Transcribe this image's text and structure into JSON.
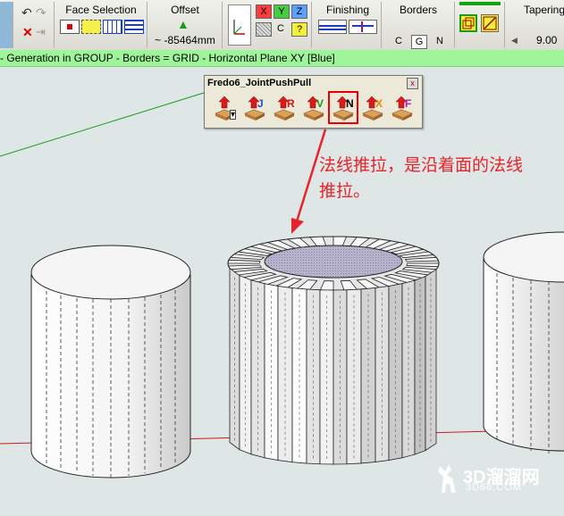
{
  "toolbar": {
    "face_selection_label": "Face Selection",
    "offset_label": "Offset",
    "offset_value": "~ -85464mm",
    "axis_x": "X",
    "axis_y": "Y",
    "axis_z": "Z",
    "axis_c": "C",
    "axis_q": "?",
    "finishing_label": "Finishing",
    "borders_label": "Borders",
    "borders_c": "C",
    "borders_g": "G",
    "borders_n": "N",
    "tapering_label": "Tapering",
    "tapering_value": "9.00"
  },
  "status": {
    "text": "- Generation in GROUP - Borders = GRID - Horizontal Plane XY [Blue]"
  },
  "palette": {
    "title": "Fredo6_JointPushPull",
    "close_label": "x",
    "tools": [
      {
        "letter": "",
        "color": "#000000",
        "icon": "push-pull-menu-icon"
      },
      {
        "letter": "J",
        "color": "#1e4fd6",
        "icon": "joint-push-pull-icon"
      },
      {
        "letter": "R",
        "color": "#d01818",
        "icon": "round-push-pull-icon"
      },
      {
        "letter": "V",
        "color": "#1a9a1a",
        "icon": "vector-push-pull-icon"
      },
      {
        "letter": "N",
        "color": "#000000",
        "icon": "normal-push-pull-icon"
      },
      {
        "letter": "X",
        "color": "#e08a00",
        "icon": "extrude-push-pull-icon"
      },
      {
        "letter": "F",
        "color": "#b01fb0",
        "icon": "follow-push-pull-icon"
      }
    ]
  },
  "annotation": {
    "line1": "法线推拉，是沿着面的法线",
    "line2": "推拉。",
    "color": "#e8232b"
  },
  "watermark": {
    "text": "3D溜溜网",
    "url": "3D66.COM"
  },
  "colors": {
    "status_bg": "#9ff59a",
    "cap_fill": "#b7b3cf",
    "red_axis": "#c81e1e",
    "green_axis": "#1f9a1f"
  }
}
